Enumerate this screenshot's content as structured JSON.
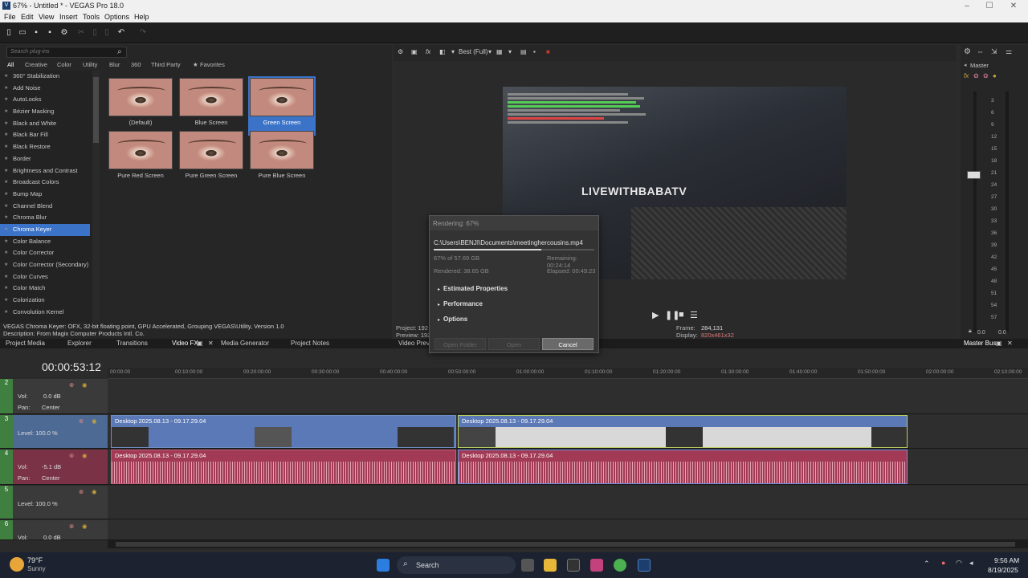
{
  "window": {
    "title": "67% - Untitled * - VEGAS Pro 18.0",
    "app_icon": "V"
  },
  "menu": [
    "File",
    "Edit",
    "View",
    "Insert",
    "Tools",
    "Options",
    "Help"
  ],
  "fx": {
    "search_placeholder": "Search plug-ins",
    "tabs": [
      "All",
      "Creative",
      "Color",
      "Utility",
      "Blur",
      "360",
      "Third Party",
      "Favorites"
    ],
    "items": [
      "360° Stabilization",
      "Add Noise",
      "AutoLooks",
      "Bézier Masking",
      "Black and White",
      "Black Bar Fill",
      "Black Restore",
      "Border",
      "Brightness and Contrast",
      "Broadcast Colors",
      "Bump Map",
      "Channel Blend",
      "Chroma Blur",
      "Chroma Keyer",
      "Color Balance",
      "Color Corrector",
      "Color Corrector (Secondary)",
      "Color Curves",
      "Color Match",
      "Colorization",
      "Convolution Kernel"
    ],
    "selected": "Chroma Keyer",
    "presets": [
      "(Default)",
      "Blue Screen",
      "Green Screen",
      "Pure Red Screen",
      "Pure Green Screen",
      "Pure Blue Screen"
    ],
    "selected_preset": "Green Screen",
    "desc1": "VEGAS Chroma Keyer: OFX, 32-bit floating point, GPU Accelerated, Grouping VEGAS\\Utility, Version 1.0",
    "desc2": "Description: From Magix Computer Products Intl. Co."
  },
  "preview": {
    "quality": "Best (Full)",
    "watermark": "LIVEWITHBABATV",
    "project": "Project:  192",
    "preview_label": "Preview:  192",
    "video_preview": "Video Previe",
    "frame_label": "Frame:",
    "frame_value": "284,131",
    "display_label": "Display:",
    "display_value": "820x461x32"
  },
  "mixer": {
    "title": "Master",
    "ticks": [
      "3",
      "6",
      "9",
      "12",
      "15",
      "18",
      "21",
      "24",
      "27",
      "30",
      "33",
      "36",
      "39",
      "42",
      "45",
      "48",
      "51",
      "54",
      "57"
    ],
    "foot": [
      "0.0",
      "0.0"
    ],
    "bus": "Master Bus"
  },
  "tabs": [
    "Project Media",
    "Explorer",
    "Transitions",
    "Video FX",
    "Media Generator",
    "Project Notes"
  ],
  "timeline": {
    "timecode": "00:00:53:12",
    "ruler": [
      "00:00:00",
      "00:10:00:00",
      "00:20:00:00",
      "00:30:00:00",
      "00:40:00:00",
      "00:50:00:00",
      "01:00:00:00",
      "01:10:00:00",
      "01:20:00:00",
      "01:30:00:00",
      "01:40:00:00",
      "01:50:00:00",
      "02:00:00:00",
      "02:10:00:00"
    ],
    "tracks": [
      {
        "num": "2",
        "vol_label": "Vol:",
        "vol": "0.0 dB",
        "pan_label": "Pan:",
        "pan": "Center"
      },
      {
        "num": "3",
        "level": "Level: 100.0 %"
      },
      {
        "num": "4",
        "vol_label": "Vol:",
        "vol": "-5.1 dB",
        "pan_label": "Pan:",
        "pan": "Center"
      },
      {
        "num": "5",
        "level": "Level: 100.0 %"
      },
      {
        "num": "6",
        "vol_label": "Vol:",
        "vol": "0.0 dB"
      }
    ],
    "clip_name": "Desktop 2025.08.13 - 09.17.29.04"
  },
  "render": {
    "title": "Rendering: 67%",
    "path": "C:\\Users\\BENJI\\Documents\\meetinghercousins.mp4",
    "progress": 0.67,
    "progress_text": "67% of 57.69 GB",
    "remaining": "Remaining: 00:24:14",
    "rendered": "Rendered: 38.65 GB",
    "elapsed": "Elapsed: 00:49:23",
    "sections": [
      "Estimated Properties",
      "Performance",
      "Options"
    ],
    "buttons": [
      "Open Folder",
      "Open",
      "Cancel"
    ]
  },
  "taskbar": {
    "weather_temp": "79°F",
    "weather_desc": "Sunny",
    "search": "Search",
    "time": "9:56 AM",
    "date": "8/19/2025"
  }
}
